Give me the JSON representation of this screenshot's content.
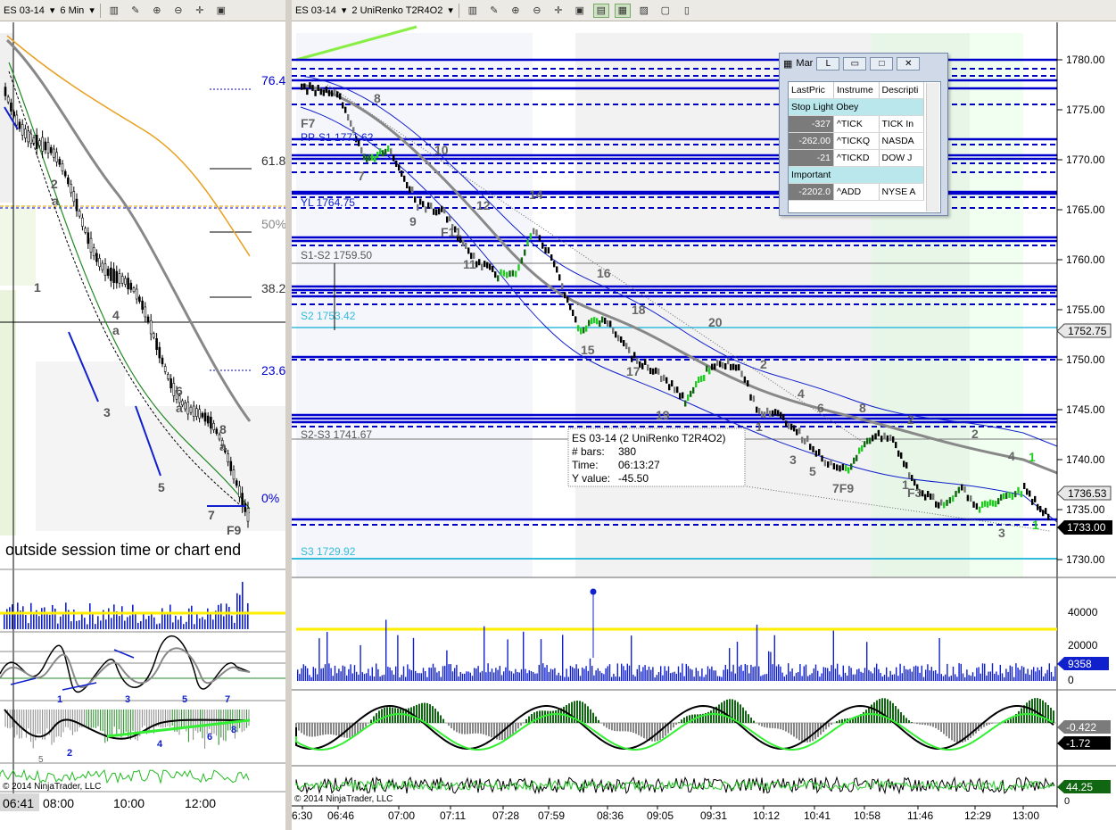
{
  "left_window": {
    "instrument": "ES 03-14",
    "period": "6 Min",
    "fib_levels": [
      "76.4",
      "61.8",
      "50%",
      "38.2",
      "23.6",
      "0%"
    ],
    "swing_labels": [
      "1",
      "2",
      "a",
      "3",
      "4",
      "a",
      "5",
      "6",
      "a",
      "7",
      "8",
      "a",
      "F9"
    ],
    "message": "outside session time or chart end",
    "osc_labels": [
      "1",
      "3",
      "5",
      "7",
      "2",
      "4",
      "6",
      "8",
      "5"
    ],
    "copyright": "© 2014 NinjaTrader, LLC",
    "time_cursor": "06:41",
    "time_labels": [
      "08:00",
      "10:00",
      "12:00"
    ]
  },
  "right_window": {
    "instrument": "ES 03-14",
    "period": "2 UniRenko T2R4O2",
    "price_labels": [
      "1780.00",
      "1775.00",
      "1770.00",
      "1765.00",
      "1760.00",
      "1755.00",
      "1750.00",
      "1745.00",
      "1740.00",
      "1735.00",
      "1730.00"
    ],
    "price_markers": {
      "last_high": "1752.75",
      "mid": "1736.53",
      "last": "1733.00"
    },
    "pivot_labels": {
      "s1_s2": "S1-S2 1759.50",
      "s2_s3": "S2-S3 1741.67",
      "s3": "S3 1729.92",
      "yl": "YL 1764.75",
      "pp": "PP-S1 1771.62",
      "s2": "S2 1753.42"
    },
    "swing_labels": [
      "F7",
      "7",
      "8",
      "9",
      "10",
      "11",
      "F11",
      "12",
      "14",
      "15",
      "16",
      "17",
      "18",
      "19",
      "20",
      "1",
      "2",
      "3",
      "4",
      "5",
      "6",
      "7F9",
      "8",
      "1",
      "2",
      "F3",
      "3",
      "4",
      "2",
      "1",
      "1"
    ],
    "data_box": {
      "title": "ES 03-14 (2 UniRenko T2R4O2)",
      "rows": [
        {
          "k": "# bars:",
          "v": "380"
        },
        {
          "k": "Time:",
          "v": "06:13:27"
        },
        {
          "k": "Y value:",
          "v": "-45.50"
        }
      ]
    },
    "volume_axis": [
      "40000",
      "20000",
      "0"
    ],
    "volume_marker": "9358",
    "osc_markers": [
      "-0.422",
      "-1.72"
    ],
    "cci_marker": "44.25",
    "cci_axis": "0",
    "copyright": "© 2014 NinjaTrader, LLC",
    "time_labels": [
      "6:30",
      "06:46",
      "07:00",
      "07:11",
      "07:28",
      "07:59",
      "08:36",
      "09:05",
      "09:31",
      "10:12",
      "10:41",
      "10:58",
      "11:46",
      "12:29",
      "13:00"
    ]
  },
  "market_analyzer": {
    "title": "Mar",
    "button_l": "L",
    "columns": [
      "LastPric",
      "Instrume",
      "Descripti"
    ],
    "sections": [
      {
        "name": "Stop Light Obey",
        "rows": [
          {
            "last": "-327",
            "instr": "^TICK",
            "desc": "TICK In"
          },
          {
            "last": "-262.00",
            "instr": "^TICKQ",
            "desc": "NASDA"
          },
          {
            "last": "-21",
            "instr": "^TICKD",
            "desc": "DOW J"
          }
        ]
      },
      {
        "name": "Important",
        "rows": [
          {
            "last": "-2202.0",
            "instr": "^ADD",
            "desc": "NYSE A"
          }
        ]
      }
    ]
  },
  "colors": {
    "pivot_blue": "#0000cc",
    "s3_cyan": "#33bbdd",
    "up_green": "#33cc33",
    "dark_green": "#116611",
    "volume_yellow": "#ffee00"
  }
}
